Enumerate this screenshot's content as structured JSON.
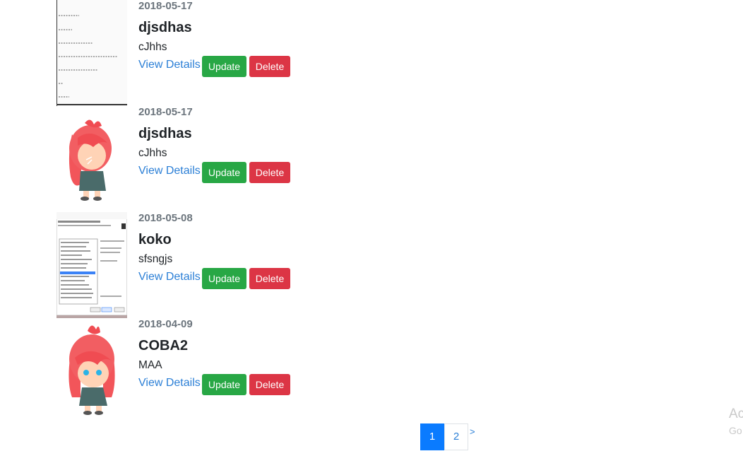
{
  "posts": [
    {
      "date": "2018-05-17",
      "title": "djsdhas",
      "subtitle": "cJhhs",
      "thumb": "terminal-screenshot-image"
    },
    {
      "date": "2018-05-17",
      "title": "djsdhas",
      "subtitle": "cJhhs",
      "thumb": "anime-girl-side-image"
    },
    {
      "date": "2018-05-08",
      "title": "koko",
      "subtitle": "sfsngjs",
      "thumb": "installer-screenshot-image"
    },
    {
      "date": "2018-04-09",
      "title": "COBA2",
      "subtitle": "MAA",
      "thumb": "anime-girl-front-image"
    }
  ],
  "actions": {
    "view_label": "View Details",
    "update_label": "Update",
    "delete_label": "Delete"
  },
  "pagination": {
    "pages": [
      "1",
      "2"
    ],
    "active": "1",
    "next_label": ">"
  },
  "watermark": {
    "line1": "Ac",
    "line2": "Go"
  },
  "colors": {
    "update": "#28a745",
    "delete": "#dc3545",
    "link": "#2b7fd6",
    "active_page": "#0a7bff"
  }
}
